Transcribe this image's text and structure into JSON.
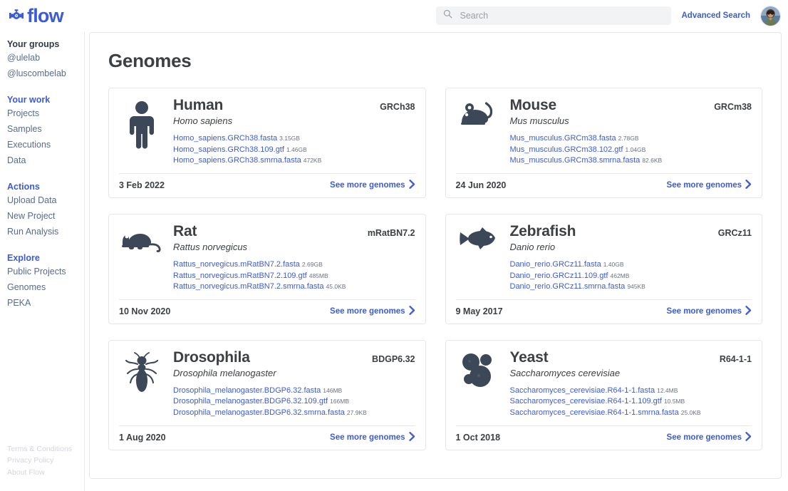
{
  "brand": {
    "name": "flow",
    "logo_icon": "flow-valve-logo-icon"
  },
  "header": {
    "search": {
      "placeholder": "Search",
      "value": "",
      "icon": "search-icon"
    },
    "advanced_search_label": "Advanced Search",
    "avatar_icon": "user-avatar-photo"
  },
  "sidebar": {
    "groups": [
      {
        "heading": "Your groups",
        "accent": false,
        "items": [
          {
            "label": "@ulelab"
          },
          {
            "label": "@luscombelab"
          }
        ]
      },
      {
        "heading": "Your work",
        "accent": true,
        "items": [
          {
            "label": "Projects"
          },
          {
            "label": "Samples"
          },
          {
            "label": "Executions"
          },
          {
            "label": "Data"
          }
        ]
      },
      {
        "heading": "Actions",
        "accent": true,
        "items": [
          {
            "label": "Upload Data"
          },
          {
            "label": "New Project"
          },
          {
            "label": "Run Analysis"
          }
        ]
      },
      {
        "heading": "Explore",
        "accent": true,
        "items": [
          {
            "label": "Public Projects"
          },
          {
            "label": "Genomes"
          },
          {
            "label": "PEKA"
          }
        ]
      }
    ],
    "footer_links": [
      {
        "label": "Terms & Conditions"
      },
      {
        "label": "Privacy Policy"
      },
      {
        "label": "About Flow"
      }
    ]
  },
  "main": {
    "page_title": "Genomes",
    "see_more_label": "See more genomes",
    "genomes": [
      {
        "name": "Human",
        "species": "Homo sapiens",
        "assembly": "GRCh38",
        "icon": "human-figure-icon",
        "date": "3 Feb 2022",
        "files": [
          {
            "name": "Homo_sapiens.GRCh38.fasta",
            "size": "3.15GB"
          },
          {
            "name": "Homo_sapiens.GRCh38.109.gtf",
            "size": "1.46GB"
          },
          {
            "name": "Homo_sapiens.GRCh38.smrna.fasta",
            "size": "472KB"
          }
        ]
      },
      {
        "name": "Mouse",
        "species": "Mus musculus",
        "assembly": "GRCm38",
        "icon": "mouse-icon",
        "date": "24 Jun 2020",
        "files": [
          {
            "name": "Mus_musculus.GRCm38.fasta",
            "size": "2.78GB"
          },
          {
            "name": "Mus_musculus.GRCm38.102.gtf",
            "size": "1.04GB"
          },
          {
            "name": "Mus_musculus.GRCm38.smrna.fasta",
            "size": "82.6KB"
          }
        ]
      },
      {
        "name": "Rat",
        "species": "Rattus norvegicus",
        "assembly": "mRatBN7.2",
        "icon": "rat-icon",
        "date": "10 Nov 2020",
        "files": [
          {
            "name": "Rattus_norvegicus.mRatBN7.2.fasta",
            "size": "2.69GB"
          },
          {
            "name": "Rattus_norvegicus.mRatBN7.2.109.gtf",
            "size": "485MB"
          },
          {
            "name": "Rattus_norvegicus.mRatBN7.2.smrna.fasta",
            "size": "45.0KB"
          }
        ]
      },
      {
        "name": "Zebrafish",
        "species": "Danio rerio",
        "assembly": "GRCz11",
        "icon": "fish-icon",
        "date": "9 May 2017",
        "files": [
          {
            "name": "Danio_rerio.GRCz11.fasta",
            "size": "1.40GB"
          },
          {
            "name": "Danio_rerio.GRCz11.109.gtf",
            "size": "462MB"
          },
          {
            "name": "Danio_rerio.GRCz11.smrna.fasta",
            "size": "945KB"
          }
        ]
      },
      {
        "name": "Drosophila",
        "species": "Drosophila melanogaster",
        "assembly": "BDGP6.32",
        "icon": "fly-icon",
        "date": "1 Aug 2020",
        "files": [
          {
            "name": "Drosophila_melanogaster.BDGP6.32.fasta",
            "size": "146MB"
          },
          {
            "name": "Drosophila_melanogaster.BDGP6.32.109.gtf",
            "size": "166MB"
          },
          {
            "name": "Drosophila_melanogaster.BDGP6.32.smrna.fasta",
            "size": "27.9KB"
          }
        ]
      },
      {
        "name": "Yeast",
        "species": "Saccharomyces cerevisiae",
        "assembly": "R64-1-1",
        "icon": "yeast-cells-icon",
        "date": "1 Oct 2018",
        "files": [
          {
            "name": "Saccharomyces_cerevisiae.R64-1-1.fasta",
            "size": "12.4MB"
          },
          {
            "name": "Saccharomyces_cerevisiae.R64-1-1.109.gtf",
            "size": "10.5MB"
          },
          {
            "name": "Saccharomyces_cerevisiae.R64-1-1.smrna.fasta",
            "size": "25.0KB"
          }
        ]
      }
    ]
  },
  "colors": {
    "accent": "#3b5bdb",
    "text": "#3c4043",
    "icon": "#3c4858",
    "border": "#e4e7eb"
  }
}
